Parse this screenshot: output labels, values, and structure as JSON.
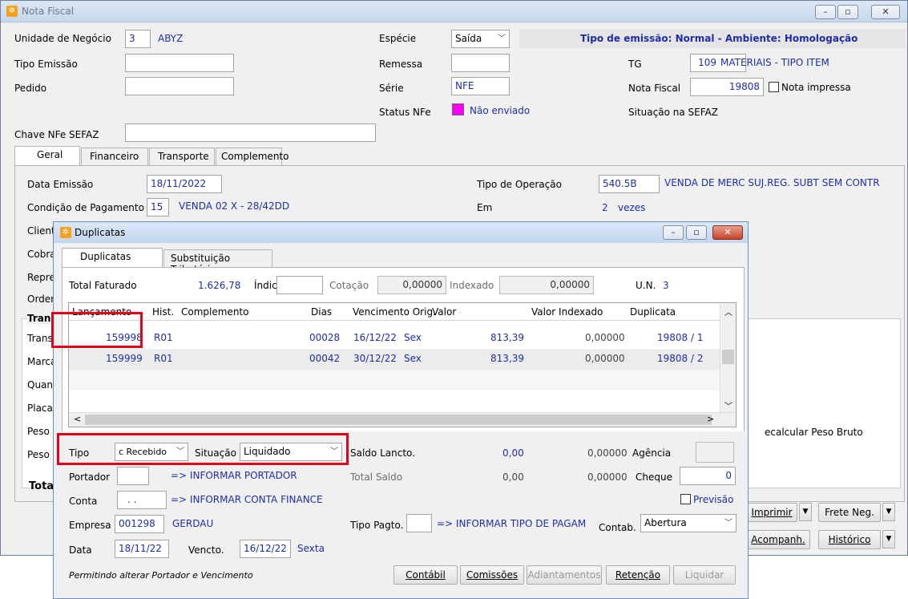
{
  "main": {
    "title": "Nota Fiscal",
    "unidade_label": "Unidade de Negócio",
    "unidade_code": "3",
    "unidade_name": "ABYZ",
    "especie_label": "Espécie",
    "especie_value": "Saída",
    "tipo_emissao_banner": "Tipo de emissão: Normal - Ambiente: Homologação",
    "tipo_emissao_label": "Tipo Emissão",
    "remessa_label": "Remessa",
    "tg_label": "TG",
    "tg_code": "109",
    "tg_name": "MATERIAIS - TIPO ITEM",
    "pedido_label": "Pedido",
    "serie_label": "Série",
    "serie_value": "NFE",
    "nota_fiscal_label": "Nota Fiscal",
    "nota_fiscal_value": "19808",
    "nota_impressa_label": "Nota impressa",
    "status_label": "Status NFe",
    "status_value": "Não enviado",
    "status_color": "#ff00ff",
    "situacao_sefaz_label": "Situação na SEFAZ",
    "chave_label": "Chave NFe SEFAZ",
    "tabs": [
      "Geral",
      "Financeiro",
      "Transporte",
      "Complemento"
    ],
    "data_emissao_label": "Data Emissão",
    "data_emissao_value": "18/11/2022",
    "tipo_operacao_label": "Tipo de Operação",
    "tipo_operacao_code": "540.5B",
    "tipo_operacao_name": "VENDA DE MERC SUJ.REG. SUBT SEM CONTR",
    "condicao_label": "Condição de Pagamento",
    "condicao_code": "15",
    "condicao_name": "VENDA 02 X - 28/42DD",
    "em_label": "Em",
    "em_value": "2",
    "vezes_label": "vezes",
    "side_labels": [
      "Cliente",
      "Cobra",
      "Repre",
      "Ordem",
      "Tran",
      "Transp",
      "Marca",
      "Quant",
      "Placa",
      "Peso L",
      "Peso B",
      "Total"
    ],
    "recalcular_label": "ecalcular Peso Bruto",
    "btn_imprimir": "Imprimir",
    "btn_frete": "Frete Neg.",
    "btn_acompanh": "Acompanh.",
    "btn_historico": "Histórico"
  },
  "dialog": {
    "title": "Duplicatas",
    "tabs": [
      "Duplicatas",
      "Substituição Tributária"
    ],
    "total_faturado_label": "Total Faturado",
    "total_faturado_value": "1.626,78",
    "indice_label": "Índice",
    "cotacao_label": "Cotação",
    "cotacao_value": "0,00000",
    "indexado_label": "Indexado",
    "indexado_value": "0,00000",
    "un_label": "U.N.",
    "un_value": "3",
    "columns": [
      "Lançamento",
      "Hist.",
      "Complemento",
      "Dias",
      "Vencimento Orig.",
      "Valor",
      "Valor Indexado",
      "Duplicata"
    ],
    "rows": [
      {
        "lanc": "159998",
        "hist": "R01",
        "dias": "00028",
        "venc": "16/12/22",
        "dia": "Sex",
        "valor": "813,39",
        "indexado": "0,00000",
        "duplicata": "19808 / 1"
      },
      {
        "lanc": "159999",
        "hist": "R01",
        "dias": "00042",
        "venc": "30/12/22",
        "dia": "Sex",
        "valor": "813,39",
        "indexado": "0,00000",
        "duplicata": "19808 / 2"
      }
    ],
    "tipo_label": "Tipo",
    "tipo_value": "c Recebido",
    "situacao_label": "Situação",
    "situacao_value": "Liquidado",
    "saldo_lancto_label": "Saldo Lancto.",
    "saldo_lancto_value": "0,00",
    "saldo_lancto_idx": "0,00000",
    "agencia_label": "Agência",
    "portador_label": "Portador",
    "portador_hint": "=> INFORMAR PORTADOR",
    "total_saldo_label": "Total Saldo",
    "total_saldo_value": "0,00",
    "total_saldo_idx": "0,00000",
    "cheque_label": "Cheque",
    "cheque_value": "0",
    "conta_label": "Conta",
    "conta_value": ". .",
    "conta_hint": "=> INFORMAR CONTA FINANCE",
    "previsao_label": "Previsão",
    "empresa_label": "Empresa",
    "empresa_code": "001298",
    "empresa_name": "GERDAU",
    "tipo_pagto_label": "Tipo Pagto.",
    "tipo_pagto_hint": "=> INFORMAR TIPO DE PAGAM",
    "contab_label": "Contab.",
    "contab_value": "Abertura",
    "data_label": "Data",
    "data_value": "18/11/22",
    "vencto_label": "Vencto.",
    "vencto_value": "16/12/22",
    "vencto_day": "Sexta",
    "footer_note": "Permitindo alterar Portador e Vencimento",
    "btn_contabil": "Contábil",
    "btn_comissoes": "Comissões",
    "btn_adiantamentos": "Adiantamentos",
    "btn_retencao": "Retenção",
    "btn_liquidar": "Liquidar"
  }
}
